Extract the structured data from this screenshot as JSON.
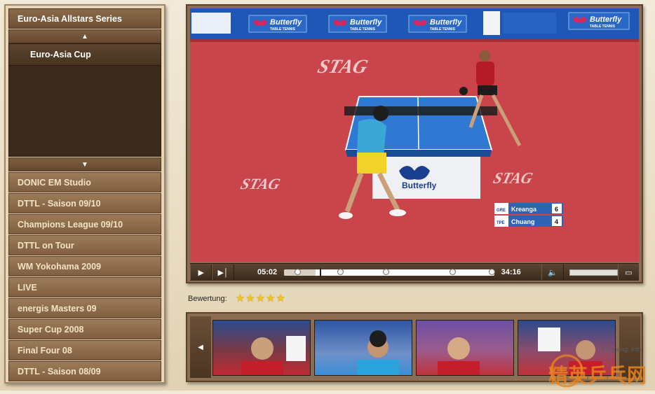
{
  "sidebar": {
    "header": "Euro-Asia Allstars Series",
    "up_icon": "triangle-up-icon",
    "sub_items": [
      "Euro-Asia Cup"
    ],
    "down_icon": "triangle-down-icon",
    "items": [
      "DONIC EM Studio",
      "DTTL - Saison 09/10",
      "Champions League 09/10",
      "DTTL on Tour",
      "WM Yokohama 2009",
      "LIVE",
      "energis Masters 09",
      "Super Cup 2008",
      "Final Four 08",
      "DTTL - Saison 08/09"
    ]
  },
  "video": {
    "banner_brand": "Butterfly",
    "banner_sub": "TABLE TENNIS",
    "floor_text": "STAG",
    "score": {
      "p1": {
        "country": "GRE",
        "name": "Kreanga",
        "points": "6"
      },
      "p2": {
        "country": "TPE",
        "name": "Chuang",
        "points": "4"
      }
    }
  },
  "controls": {
    "elapsed": "05:02",
    "duration": "34:16",
    "progress": 0.147,
    "volume": 1.0
  },
  "rating": {
    "label": "Bewertung:",
    "stars": 5
  },
  "watermark": {
    "url": "pingpang. info",
    "text": "精英乒乓网"
  },
  "colors": {
    "sidebar_item": "#8d6d4c",
    "sidebar_dark": "#3b2a1c",
    "floor": "#c9444b",
    "star": "#f1c521"
  }
}
